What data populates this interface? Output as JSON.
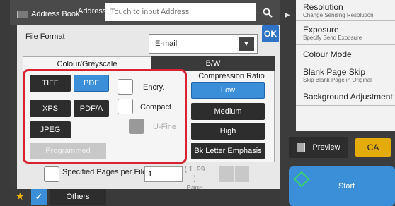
{
  "header": {
    "address_book_label": "Address Book",
    "address_label": "Address",
    "address_placeholder": "Touch to input Address"
  },
  "file_format": {
    "label": "File Format",
    "selected": "E-mail",
    "ok_label": "OK"
  },
  "tabs": [
    {
      "label": "Colour/Greyscale"
    },
    {
      "label": "B/W"
    }
  ],
  "formats": {
    "tiff": "TIFF",
    "pdf": "PDF",
    "xps": "XPS",
    "pdfa": "PDF/A",
    "jpeg": "JPEG",
    "programmed": "Programmed"
  },
  "options": {
    "encry": "Encry.",
    "compact": "Compact",
    "ufine": "U-Fine"
  },
  "compression": {
    "title": "Compression Ratio",
    "low": "Low",
    "medium": "Medium",
    "high": "High",
    "bk_letter": "Bk Letter Emphasis"
  },
  "specified_pages": {
    "label": "Specified Pages per File",
    "value": "1",
    "range": "( 1~99 )",
    "unit": "Page"
  },
  "bottom": {
    "others_label": "Others"
  },
  "right_menu": [
    {
      "label": "Resolution",
      "sub": "Change Sending Resolution"
    },
    {
      "label": "Exposure",
      "sub": "Specify Send Exposure"
    },
    {
      "label": "Colour Mode",
      "sub": ""
    },
    {
      "label": "Blank Page Skip",
      "sub": "Skip Blank Page in Original"
    },
    {
      "label": "Background Adjustment",
      "sub": ""
    }
  ],
  "actions": {
    "preview_label": "Preview",
    "ca_label": "CA",
    "start_label": "Start"
  },
  "colors": {
    "accent_blue": "#3b8fd9",
    "highlight_red": "#d9232e",
    "ca_yellow": "#e3ac0b"
  }
}
